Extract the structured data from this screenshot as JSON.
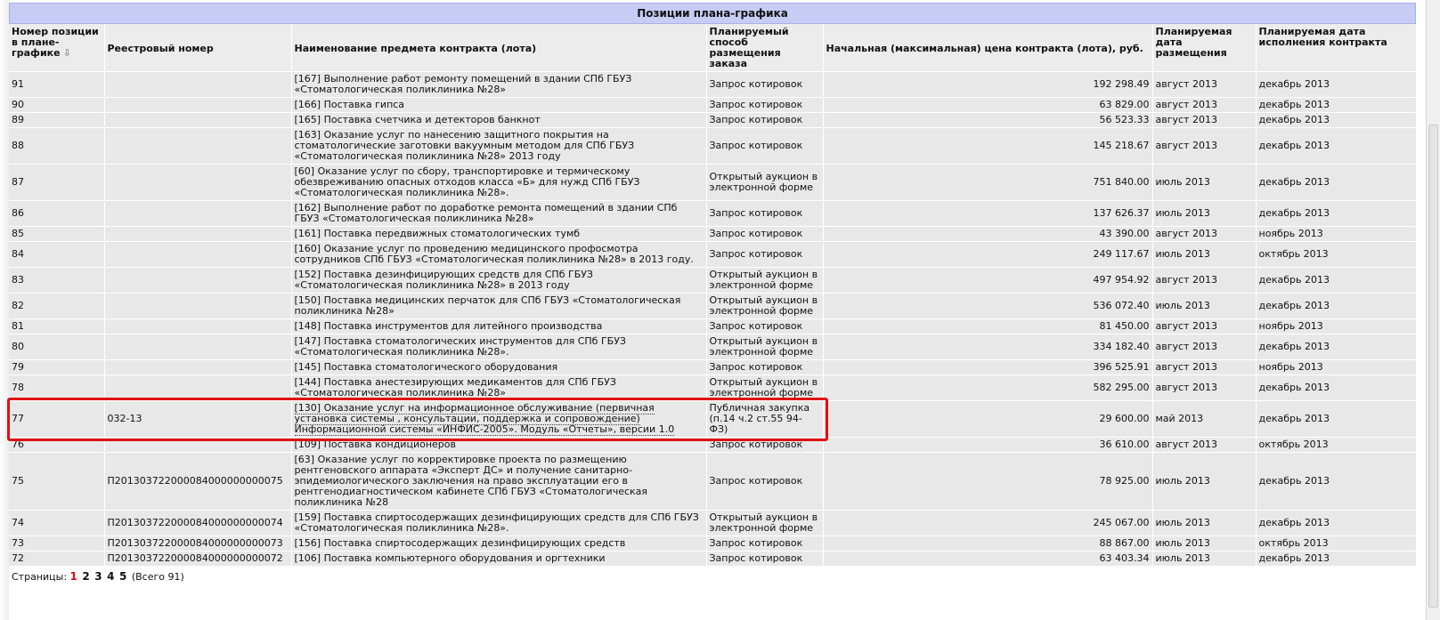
{
  "panel": {
    "title": "Позиции плана-графика"
  },
  "columns": [
    "Номер позиции в плане-графике",
    "Реестровый номер",
    "Наименование предмета контракта (лота)",
    "Планируемый способ размещения заказа",
    "Начальная (максимальная) цена контракта (лота), руб.",
    "Планируемая дата размещения",
    "Планируемая дата исполнения контракта"
  ],
  "sort_icon": "sort-down-arrow-icon",
  "rows": [
    {
      "pos": "91",
      "reg": "",
      "name": "[167] Выполнение работ ремонту помещений в здании СПб ГБУЗ «Стоматологическая поликлиника №28»",
      "method": "Запрос котировок",
      "price": "192 298.49",
      "place": "август 2013",
      "exec": "декабрь 2013"
    },
    {
      "pos": "90",
      "reg": "",
      "name": "[166] Поставка гипса",
      "method": "Запрос котировок",
      "price": "63 829.00",
      "place": "август 2013",
      "exec": "декабрь 2013"
    },
    {
      "pos": "89",
      "reg": "",
      "name": "[165] Поставка счетчика и детекторов банкнот",
      "method": "Запрос котировок",
      "price": "56 523.33",
      "place": "август 2013",
      "exec": "декабрь 2013"
    },
    {
      "pos": "88",
      "reg": "",
      "name": "[163] Оказание услуг по нанесению защитного покрытия на стоматологические заготовки вакуумным методом для СПб ГБУЗ «Стоматологическая поликлиника №28» 2013 году",
      "method": "Запрос котировок",
      "price": "145 218.67",
      "place": "август 2013",
      "exec": "декабрь 2013"
    },
    {
      "pos": "87",
      "reg": "",
      "name": "[60] Оказание услуг по сбору, транспортировке и термическому обезвреживанию опасных отходов класса «Б» для нужд СПб ГБУЗ «Стоматологическая поликлиника №28».",
      "method": "Открытый аукцион в электронной форме",
      "price": "751 840.00",
      "place": "июль 2013",
      "exec": "декабрь 2013"
    },
    {
      "pos": "86",
      "reg": "",
      "name": "[162] Выполнение работ по доработке ремонта помещений в здании СПб ГБУЗ «Стоматологическая поликлиника №28»",
      "method": "Запрос котировок",
      "price": "137 626.37",
      "place": "июль 2013",
      "exec": "декабрь 2013"
    },
    {
      "pos": "85",
      "reg": "",
      "name": "[161] Поставка передвижных стоматологических тумб",
      "method": "Запрос котировок",
      "price": "43 390.00",
      "place": "август 2013",
      "exec": "ноябрь 2013"
    },
    {
      "pos": "84",
      "reg": "",
      "name": "[160] Оказание услуг по проведению медицинского профосмотра сотрудников СПб ГБУЗ «Стоматологическая поликлиника №28» в 2013 году.",
      "method": "Запрос котировок",
      "price": "249 117.67",
      "place": "июль 2013",
      "exec": "октябрь 2013"
    },
    {
      "pos": "83",
      "reg": "",
      "name": "[152] Поставка дезинфицирующих средств для СПб ГБУЗ «Стоматологическая поликлиника №28» в 2013 году",
      "method": "Открытый аукцион в электронной форме",
      "price": "497 954.92",
      "place": "август 2013",
      "exec": "декабрь 2013"
    },
    {
      "pos": "82",
      "reg": "",
      "name": "[150] Поставка медицинских перчаток для СПб ГБУЗ «Стоматологическая поликлиника №28»",
      "method": "Открытый аукцион в электронной форме",
      "price": "536 072.40",
      "place": "июль 2013",
      "exec": "декабрь 2013"
    },
    {
      "pos": "81",
      "reg": "",
      "name": "[148] Поставка инструментов для литейного производства",
      "method": "Запрос котировок",
      "price": "81 450.00",
      "place": "август 2013",
      "exec": "ноябрь 2013"
    },
    {
      "pos": "80",
      "reg": "",
      "name": "[147] Поставка стоматологических инструментов для СПб ГБУЗ «Стоматологическая поликлиника №28».",
      "method": "Открытый аукцион в электронной форме",
      "price": "334 182.40",
      "place": "август 2013",
      "exec": "декабрь 2013"
    },
    {
      "pos": "79",
      "reg": "",
      "name": "[145] Поставка стоматологического оборудования",
      "method": "Запрос котировок",
      "price": "396 525.91",
      "place": "август 2013",
      "exec": "ноябрь 2013"
    },
    {
      "pos": "78",
      "reg": "",
      "name": "[144] Поставка анестезирующих медикаментов для СПб ГБУЗ «Стоматологическая поликлиника №28»",
      "method": "Открытый аукцион в электронной форме",
      "price": "582 295.00",
      "place": "август 2013",
      "exec": "декабрь 2013"
    },
    {
      "pos": "77",
      "reg": "032-13",
      "name": "[130] Оказание услуг на информационное обслуживание (первичная установка системы , консультации, поддержка и сопровождение) Информационной системы «ИНФИС-2005». Модуль «Отчеты», версии 1.0",
      "method": "Публичная закупка (п.14 ч.2 ст.55 94-ФЗ)",
      "price": "29 600.00",
      "place": "май 2013",
      "exec": "декабрь 2013",
      "highlight": true
    },
    {
      "pos": "76",
      "reg": "",
      "name": "[109] Поставка кондиционеров",
      "method": "Запрос котировок",
      "price": "36 610.00",
      "place": "август 2013",
      "exec": "октябрь 2013"
    },
    {
      "pos": "75",
      "reg": "П201303722000084000000000075",
      "name": "[63] Оказание услуг по корректировке проекта по размещению рентгеновского аппарата «Эксперт ДС» и получение санитарно-эпидемиологического заключения на право эксплуатации его в рентгенодиагностическом кабинете СПб ГБУЗ «Стоматологическая поликлиника №28",
      "method": "Запрос котировок",
      "price": "78 925.00",
      "place": "июль 2013",
      "exec": "декабрь 2013"
    },
    {
      "pos": "74",
      "reg": "П201303722000084000000000074",
      "name": "[159] Поставка спиртосодержащих дезинфицирующих средств для СПб ГБУЗ «Стоматологическая поликлиника №28».",
      "method": "Открытый аукцион в электронной форме",
      "price": "245 067.00",
      "place": "июль 2013",
      "exec": "декабрь 2013"
    },
    {
      "pos": "73",
      "reg": "П201303722000084000000000073",
      "name": "[156] Поставка спиртосодержащих дезинфицирующих средств",
      "method": "Запрос котировок",
      "price": "88 867.00",
      "place": "июль 2013",
      "exec": "октябрь 2013"
    },
    {
      "pos": "72",
      "reg": "П201303722000084000000000072",
      "name": "[106] Поставка компьютерного оборудования и оргтехники",
      "method": "Запрос котировок",
      "price": "63 403.34",
      "place": "июль 2013",
      "exec": "декабрь 2013"
    }
  ],
  "pager": {
    "label": "Страницы:",
    "pages": [
      "1",
      "2",
      "3",
      "4",
      "5"
    ],
    "current": "1",
    "total": "(Всего 91)"
  },
  "colors": {
    "header_bar": "#c7ccf4",
    "highlight_border": "#e01010",
    "current_page": "#e01010"
  }
}
